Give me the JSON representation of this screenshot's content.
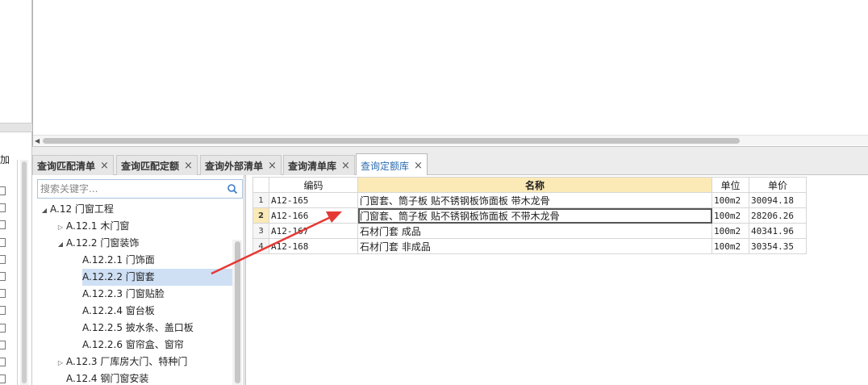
{
  "left_strip": {
    "partial_label": "加",
    "checkbox_count": 13
  },
  "tabs": [
    {
      "label": "查询匹配清单",
      "active": false
    },
    {
      "label": "查询匹配定额",
      "active": false
    },
    {
      "label": "查询外部清单",
      "active": false
    },
    {
      "label": "查询清单库",
      "active": false
    },
    {
      "label": "查询定额库",
      "active": true
    }
  ],
  "tab_close_glyph": "×",
  "search": {
    "placeholder": "搜索关键字..."
  },
  "tree": [
    {
      "label": "A.12 门窗工程",
      "level": 0,
      "toggle": "expanded"
    },
    {
      "label": "A.12.1 木门窗",
      "level": 1,
      "toggle": "collapsed"
    },
    {
      "label": "A.12.2 门窗装饰",
      "level": 1,
      "toggle": "expanded"
    },
    {
      "label": "A.12.2.1 门饰面",
      "level": 2,
      "toggle": "none"
    },
    {
      "label": "A.12.2.2 门窗套",
      "level": 2,
      "toggle": "none",
      "selected": true
    },
    {
      "label": "A.12.2.3 门窗贴脸",
      "level": 2,
      "toggle": "none"
    },
    {
      "label": "A.12.2.4 窗台板",
      "level": 2,
      "toggle": "none"
    },
    {
      "label": "A.12.2.5 披水条、盖口板",
      "level": 2,
      "toggle": "none"
    },
    {
      "label": "A.12.2.6 窗帘盒、窗帘",
      "level": 2,
      "toggle": "none"
    },
    {
      "label": "A.12.3 厂库房大门、特种门",
      "level": 1,
      "toggle": "collapsed"
    },
    {
      "label": "A.12.4 钢门窗安装",
      "level": 1,
      "toggle": "none"
    }
  ],
  "grid": {
    "columns": [
      "编码",
      "名称",
      "单位",
      "单价"
    ],
    "rows": [
      {
        "n": "1",
        "code": "A12-165",
        "name": "门窗套、筒子板 贴不锈钢板饰面板 带木龙骨",
        "unit": "100m2",
        "price": "30094.18"
      },
      {
        "n": "2",
        "code": "A12-166",
        "name": "门窗套、筒子板 贴不锈钢板饰面板 不带木龙骨",
        "unit": "100m2",
        "price": "28206.26",
        "current": true
      },
      {
        "n": "3",
        "code": "A12-167",
        "name": "石材门套 成品",
        "unit": "100m2",
        "price": "40341.96"
      },
      {
        "n": "4",
        "code": "A12-168",
        "name": "石材门套 非成品",
        "unit": "100m2",
        "price": "30354.35"
      }
    ]
  },
  "colors": {
    "arrow": "#e53935",
    "active_tab_text": "#2b6cb0",
    "header_highlight": "#fbe9b6",
    "tree_selected": "#cfe0f5"
  }
}
